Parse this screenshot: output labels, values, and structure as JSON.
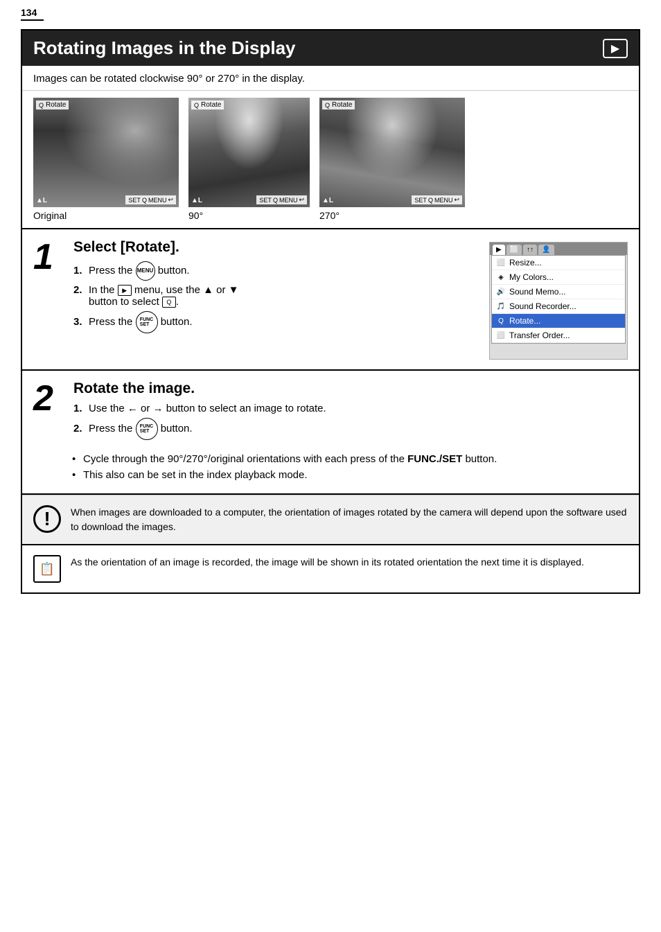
{
  "page": {
    "number": "134",
    "title": "Rotating Images in the Display",
    "playback_icon_label": "▶",
    "intro": "Images can be rotated clockwise 90° or 270° in the display.",
    "images": [
      {
        "label": "Original",
        "top_label": "Rotate",
        "rotation_class": "original"
      },
      {
        "label": "90°",
        "top_label": "Rotate",
        "rotation_class": "rotated90"
      },
      {
        "label": "270°",
        "top_label": "Rotate",
        "rotation_class": "rotated270"
      }
    ],
    "step1": {
      "number": "1",
      "title": "Select [Rotate].",
      "instructions": [
        {
          "num": "1.",
          "text_before": "Press the",
          "button": "MENU",
          "text_after": "button."
        },
        {
          "num": "2.",
          "text_before": "In the",
          "icon": "▶",
          "text_mid": "menu, use the ▲ or ▼ button to select",
          "icon2": "Q",
          "text_after": "."
        },
        {
          "num": "3.",
          "text_before": "Press the",
          "button": "FUNC/SET",
          "text_after": "button."
        }
      ],
      "menu": {
        "tabs": [
          "▶",
          "⬜",
          "↑↑",
          "👤"
        ],
        "items": [
          {
            "icon": "⬜",
            "label": "Resize...",
            "highlighted": false
          },
          {
            "icon": "◈",
            "label": "My Colors...",
            "highlighted": false
          },
          {
            "icon": "🔊",
            "label": "Sound Memo...",
            "highlighted": false
          },
          {
            "icon": "🎵",
            "label": "Sound Recorder...",
            "highlighted": false
          },
          {
            "icon": "Q",
            "label": "Rotate...",
            "highlighted": true
          },
          {
            "icon": "⬜",
            "label": "Transfer Order...",
            "highlighted": false
          }
        ]
      }
    },
    "step2": {
      "number": "2",
      "title": "Rotate the image.",
      "instructions": [
        {
          "num": "1.",
          "text": "Use the ← or → button to select an image to rotate."
        },
        {
          "num": "2.",
          "text_before": "Press the",
          "button": "FUNC/SET",
          "text_after": "button."
        }
      ],
      "bullets": [
        "Cycle through the 90°/270°/original orientations with each press of the FUNC./SET button.",
        "This also can be set in the index playback mode."
      ]
    },
    "note1": {
      "icon": "!",
      "text": "When images are downloaded to a computer, the orientation of images rotated by the camera will depend upon the software used to download the images."
    },
    "note2": {
      "text": "As the orientation of an image is recorded, the image will be shown in its rotated orientation the next time it is displayed."
    }
  }
}
